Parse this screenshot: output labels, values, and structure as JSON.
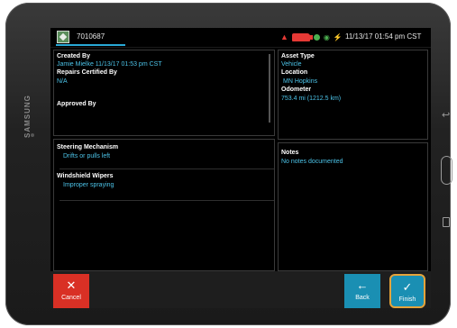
{
  "header": {
    "asset_id": "7010687",
    "datetime": "11/13/17 01:54 pm CST",
    "status_icons": [
      "warning-icon",
      "truck-icon",
      "gps-icon",
      "wifi-icon",
      "power-icon"
    ]
  },
  "details": {
    "created_by_label": "Created By",
    "created_by_value": "Jamie Mielke 11/13/17 01:53 pm CST",
    "repairs_label": "Repairs Certified By",
    "repairs_value": "N/A",
    "approved_label": "Approved By",
    "approved_value": ""
  },
  "asset": {
    "type_label": "Asset Type",
    "type_value": "Vehicle",
    "location_label": "Location",
    "location_value": "MN Hopkins",
    "odometer_label": "Odometer",
    "odometer_value": "753.4 mi (1212.5 km)"
  },
  "defects": [
    {
      "label": "Steering Mechanism",
      "value": "Drifts or pulls left"
    },
    {
      "label": "Windshield Wipers",
      "value": "Improper spraying"
    }
  ],
  "notes": {
    "label": "Notes",
    "value": "No notes documented"
  },
  "buttons": {
    "cancel": "Cancel",
    "back": "Back",
    "finish": "Finish"
  },
  "device": {
    "brand": "SAMSUNG"
  },
  "colors": {
    "accent": "#29a9d6",
    "value_text": "#4cc3e8",
    "cancel": "#d93025",
    "action": "#1a8fb3",
    "highlight": "#e5a33a"
  }
}
